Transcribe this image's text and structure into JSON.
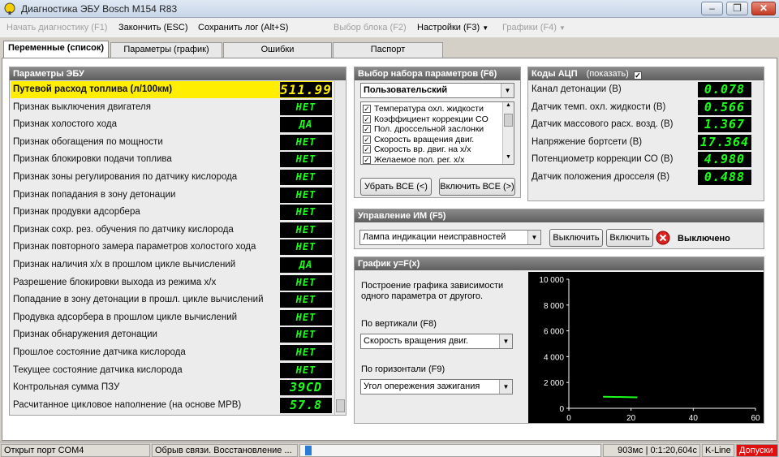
{
  "window": {
    "title": "Диагностика ЭБУ Bosch M154 R83"
  },
  "menu": {
    "start": "Начать диагностику (F1)",
    "finish": "Закончить (ESC)",
    "save_log": "Сохранить лог (Alt+S)",
    "select_block": "Выбор блока (F2)",
    "settings": "Настройки (F3)",
    "graphs": "Графики (F4)"
  },
  "tabs": [
    "Переменные (список)",
    "Параметры (график)",
    "Ошибки",
    "Паспорт"
  ],
  "ecu": {
    "title": "Параметры ЭБУ",
    "rows": [
      {
        "label": "Путевой расход топлива (л/100км)",
        "value": "511.99"
      },
      {
        "label": "Признак выключения двигателя",
        "value": "НЕТ"
      },
      {
        "label": "Признак холостого хода",
        "value": "ДА"
      },
      {
        "label": "Признак обогащения по мощности",
        "value": "НЕТ"
      },
      {
        "label": "Признак блокировки подачи топлива",
        "value": "НЕТ"
      },
      {
        "label": "Признак зоны регулирования по датчику кислорода",
        "value": "НЕТ"
      },
      {
        "label": "Признак попадания в зону детонации",
        "value": "НЕТ"
      },
      {
        "label": "Признак продувки адсорбера",
        "value": "НЕТ"
      },
      {
        "label": "Признак сохр. рез. обучения по датчику кислорода",
        "value": "НЕТ"
      },
      {
        "label": "Признак повторного замера параметров холостого хода",
        "value": "НЕТ"
      },
      {
        "label": "Признак наличия х/х в прошлом цикле вычислений",
        "value": "ДА"
      },
      {
        "label": "Разрешение блокировки выхода из режима х/х",
        "value": "НЕТ"
      },
      {
        "label": "Попадание в зону детонации в прошл. цикле вычислений",
        "value": "НЕТ"
      },
      {
        "label": "Продувка адсорбера в прошлом цикле вычислений",
        "value": "НЕТ"
      },
      {
        "label": "Признак обнаружения детонации",
        "value": "НЕТ"
      },
      {
        "label": "Прошлое состояние датчика кислорода",
        "value": "НЕТ"
      },
      {
        "label": "Текущее состояние датчика кислорода",
        "value": "НЕТ"
      },
      {
        "label": "Контрольная сумма ПЗУ",
        "value": "39CD"
      },
      {
        "label": "Расчитанное цикловое наполнение (на основе МРВ)",
        "value": "57.8"
      }
    ]
  },
  "paramset": {
    "title": "Выбор набора параметров (F6)",
    "selected": "Пользовательский",
    "items": [
      {
        "label": "Температура охл. жидкости",
        "checked": true
      },
      {
        "label": "Коэффициент коррекции CO",
        "checked": true
      },
      {
        "label": "Пол. дроссельной заслонки",
        "checked": true
      },
      {
        "label": "Скорость вращения двиг.",
        "checked": true
      },
      {
        "label": "Скорость вр. двиг. на х/х",
        "checked": true
      },
      {
        "label": "Желаемое пол. рег. х/х",
        "checked": true
      }
    ],
    "remove_all": "Убрать ВСЕ (<)",
    "add_all": "Включить ВСЕ (>)"
  },
  "adc": {
    "title": "Коды АЦП",
    "show_label": "(показать)",
    "show_checked": true,
    "rows": [
      {
        "label": "Канал детонации (В)",
        "value": "0.078"
      },
      {
        "label": "Датчик темп. охл. жидкости (В)",
        "value": "0.566"
      },
      {
        "label": "Датчик массового расх. возд. (В)",
        "value": "1.367"
      },
      {
        "label": "Напряжение бортсети (В)",
        "value": "17.364"
      },
      {
        "label": "Потенциометр коррекции СО (В)",
        "value": "4.980"
      },
      {
        "label": "Датчик положения дросселя (В)",
        "value": "0.488"
      }
    ]
  },
  "actuator": {
    "title": "Управление ИМ (F5)",
    "selected": "Лампа индикации неисправностей",
    "off_btn": "Выключить",
    "on_btn": "Включить",
    "state": "Выключено"
  },
  "graph": {
    "title": "График y=F(x)",
    "description_1": "Построение графика зависимости",
    "description_2": "одного параметра от другого.",
    "vertical_label": "По вертикали (F8)",
    "vertical_value": "Скорость вращения двиг.",
    "horizontal_label": "По горизонтали (F9)",
    "horizontal_value": "Угол опережения зажигания"
  },
  "chart_data": {
    "type": "line",
    "title": "",
    "xlabel": "",
    "ylabel": "",
    "xlim": [
      0,
      60
    ],
    "ylim": [
      0,
      10000
    ],
    "xticks": [
      "0",
      "20",
      "40",
      "60"
    ],
    "yticks": [
      "0",
      "2 000",
      "4 000",
      "6 000",
      "8 000",
      "10 000"
    ],
    "grid": false,
    "series": [
      {
        "x": [
          11,
          22
        ],
        "y": [
          900,
          850
        ]
      }
    ],
    "colors": {
      "line": "#1bff1b",
      "background": "#000000"
    }
  },
  "status": {
    "port": "Открыт порт COM4",
    "connection": "Обрыв связи. Восстановление ...",
    "timing": "903мс | 0:1:20,604с",
    "protocol": "K-Line",
    "admission": "Допуски"
  },
  "colors": {
    "highlight": "#ffee00",
    "lcd_green": "#1bff1b",
    "admission_bg": "#e01010"
  }
}
